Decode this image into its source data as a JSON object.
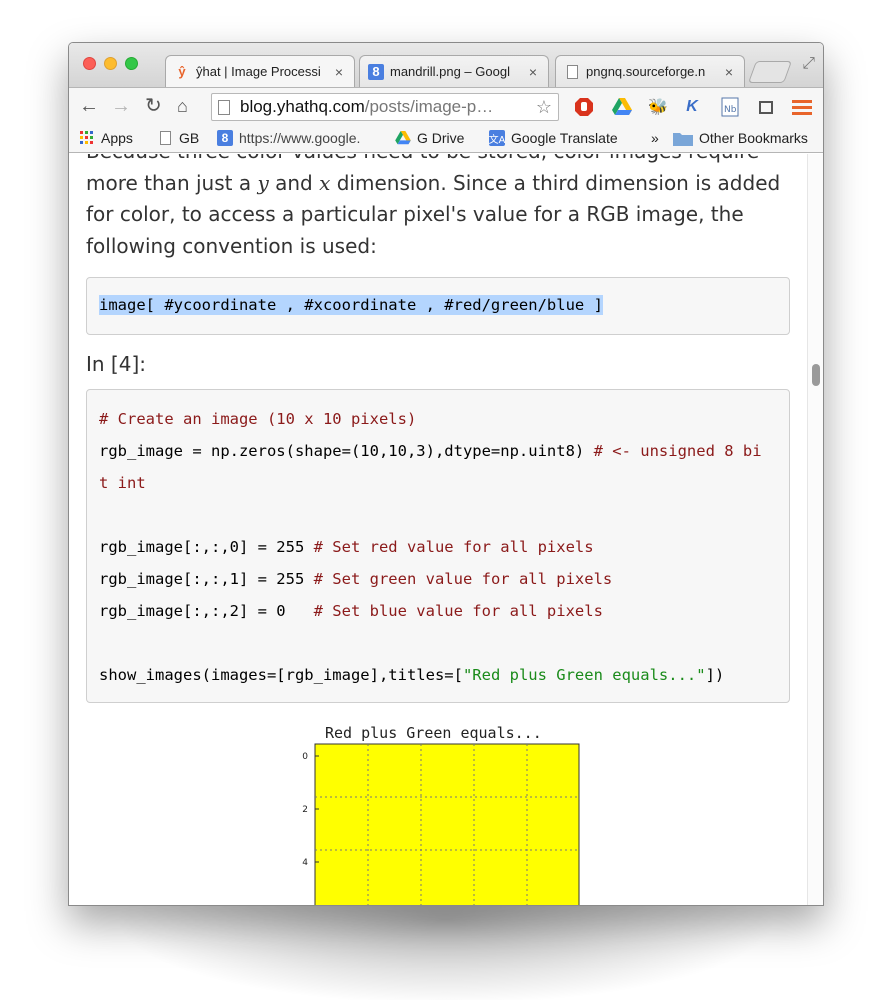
{
  "browser": {
    "tabs": [
      {
        "label": "ŷhat | Image Processi",
        "favicon": "ŷ",
        "active": true
      },
      {
        "label": "mandrill.png – Googl",
        "favicon": "8",
        "active": false
      },
      {
        "label": "pngnq.sourceforge.n",
        "favicon": "",
        "active": false
      }
    ],
    "tab_close": "×",
    "url_host": "blog.yhathq.com",
    "url_path": "/posts/image-p…",
    "bookmarks": [
      {
        "label": "Apps",
        "icon": "apps-grid-icon"
      },
      {
        "label": "GB",
        "icon": "page-icon"
      },
      {
        "label": "https://www.google.",
        "icon": "google-icon"
      },
      {
        "label": "G Drive",
        "icon": "drive-icon"
      },
      {
        "label": "Google Translate",
        "icon": "translate-icon"
      }
    ],
    "overflow_chevron": "»",
    "other_bookmarks": "Other Bookmarks"
  },
  "article": {
    "paragraph_top": "Because three color values need to be stored, color images require",
    "paragraph_a": "more than just a ",
    "var_y": "y",
    "paragraph_and": " and ",
    "var_x": "x",
    "paragraph_b": " dimension. Since a third dimension is added for color, to access a particular pixel's value for a RGB image, the following convention is used:",
    "convention_code": "image[ #ycoordinate , #xcoordinate , #red/green/blue ]",
    "prompt": "In [4]:",
    "code_lines": {
      "l1": "# Create an image (10 x 10 pixels)",
      "l2a": "rgb_image = np.zeros(shape=(10,10,3),dtype=np.uint8) ",
      "l2b": "# <- unsigned 8 bi",
      "l3": "t int",
      "l4a": "rgb_image[:,:,0] = 255 ",
      "l4b": "# Set red value for all pixels",
      "l5a": "rgb_image[:,:,1] = 255 ",
      "l5b": "# Set green value for all pixels",
      "l6a": "rgb_image[:,:,2] = 0   ",
      "l6b": "# Set blue value for all pixels",
      "l7a": "show_images(images=[rgb_image],titles=[",
      "l7b": "\"Red plus Green equals...\"",
      "l7c": "])"
    }
  },
  "chart_data": {
    "type": "heatmap",
    "title": "Red plus Green equals...",
    "fill_color": "#ffff00",
    "y_ticks": [
      0,
      2,
      4
    ],
    "grid": true
  },
  "colors": {
    "accent_orange": "#e8642b",
    "selection": "#b4d5fe",
    "comment": "#8b1a1a"
  }
}
